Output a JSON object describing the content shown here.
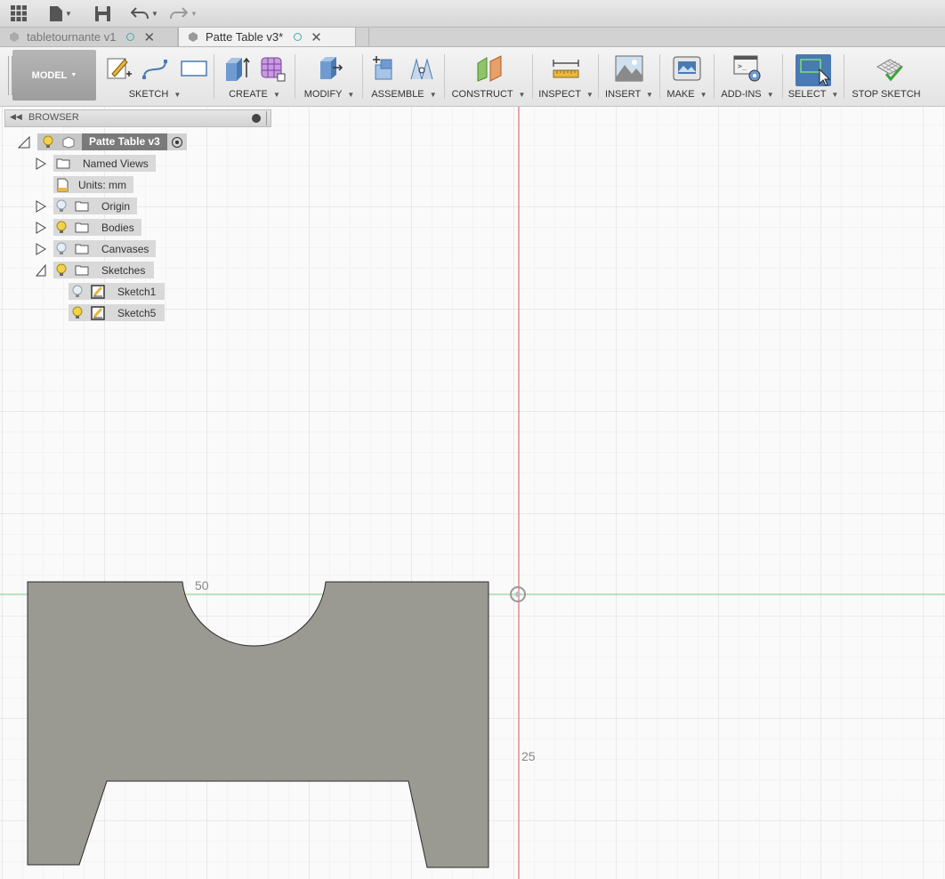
{
  "toolbar": {
    "app_menu_icon": "grid-icon",
    "file_icon": "file-icon",
    "save_icon": "save-icon",
    "undo_icon": "undo-icon",
    "redo_icon": "redo-icon"
  },
  "tabs": [
    {
      "label": "tabletournante v1",
      "active": false
    },
    {
      "label": "Patte Table v3*",
      "active": true
    }
  ],
  "ribbon": {
    "mode_label": "MODEL",
    "groups": {
      "sketch": "SKETCH",
      "create": "CREATE",
      "modify": "MODIFY",
      "assemble": "ASSEMBLE",
      "construct": "CONSTRUCT",
      "inspect": "INSPECT",
      "insert": "INSERT",
      "make": "MAKE",
      "addins": "ADD-INS",
      "select": "SELECT",
      "stop_sketch": "STOP SKETCH"
    }
  },
  "browser": {
    "title": "BROWSER",
    "root": "Patte Table v3",
    "items": {
      "named_views": "Named Views",
      "units": "Units: mm",
      "origin": "Origin",
      "bodies": "Bodies",
      "canvases": "Canvases",
      "sketches": "Sketches",
      "sketch1": "Sketch1",
      "sketch5": "Sketch5"
    }
  },
  "canvas": {
    "dim_top": "50",
    "dim_side": "25",
    "colors": {
      "part": "#9a9a92",
      "x_axis": "#7fd07f",
      "y_axis": "#e05050",
      "grid": "#e2e2e2"
    }
  }
}
